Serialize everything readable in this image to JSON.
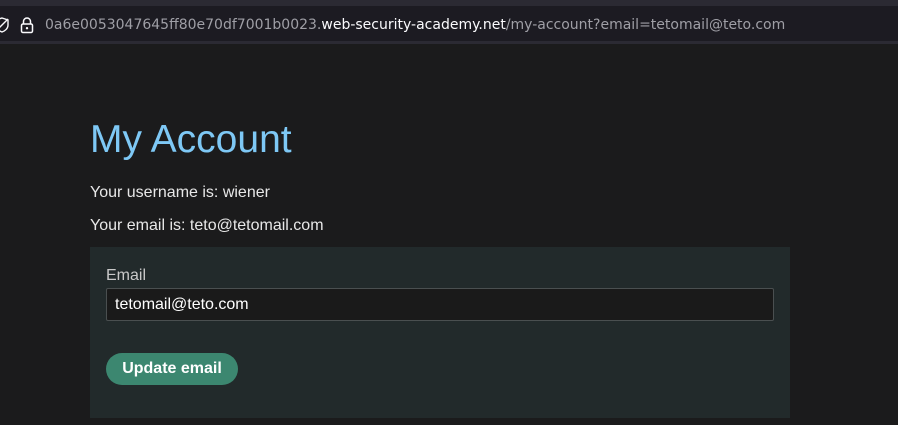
{
  "browser": {
    "url_prefix": "0a6e0053047645ff80e70df7001b0023.",
    "url_domain": "web-security-academy.net",
    "url_path": "/my-account?email=tetomail@teto.com",
    "icons": {
      "tracking": "tracking-protection-icon",
      "lock": "lock-icon"
    }
  },
  "page": {
    "title": "My Account",
    "username_line": "Your username is: wiener",
    "email_line": "Your email is: teto@tetomail.com"
  },
  "form": {
    "email_label": "Email",
    "email_value": "tetomail@teto.com",
    "submit_label": "Update email"
  },
  "colors": {
    "background": "#1b1b1c",
    "title": "#7ec8f5",
    "panel": "#222a2b",
    "button": "#3c8770"
  }
}
